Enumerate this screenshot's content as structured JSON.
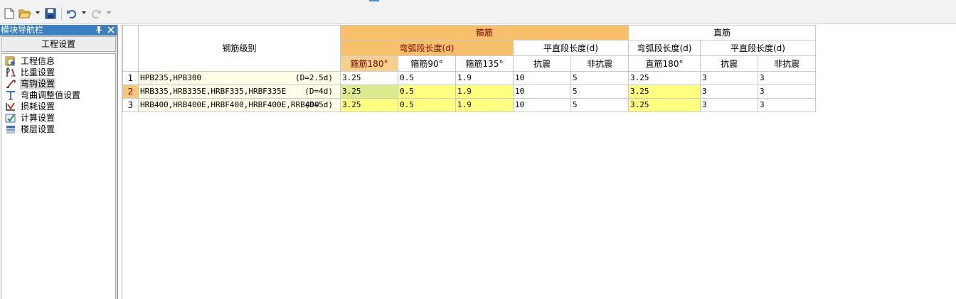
{
  "toolbar": {
    "buttons": [
      {
        "name": "new-icon"
      },
      {
        "name": "open-icon"
      },
      {
        "name": "save-icon"
      },
      {
        "name": "undo-icon"
      },
      {
        "name": "redo-icon"
      }
    ]
  },
  "navigator": {
    "title": "模块导航栏",
    "pin_glyph": "ꟼ",
    "close_glyph": "✕",
    "group": "工程设置",
    "items": [
      {
        "label": "工程信息",
        "icon": "project-info-icon"
      },
      {
        "label": "比重设置",
        "icon": "weight-ratio-icon"
      },
      {
        "label": "弯钩设置",
        "icon": "hook-icon",
        "selected": true
      },
      {
        "label": "弯曲调整值设置",
        "icon": "bend-adjust-icon"
      },
      {
        "label": "损耗设置",
        "icon": "loss-icon"
      },
      {
        "label": "计算设置",
        "icon": "calc-settings-icon"
      },
      {
        "label": "楼层设置",
        "icon": "floor-settings-icon"
      }
    ]
  },
  "grid": {
    "header": {
      "grade": "钢筋级别",
      "stirrup": "箍筋",
      "straight": "直筋",
      "stirrup_arc": "弯弧段长度(d)",
      "stirrup_flat": "平直段长度(d)",
      "straight_arc": "弯弧段长度(d)",
      "straight_flat": "平直段长度(d)",
      "cols": {
        "s180": "箍筋180°",
        "s90": "箍筋90°",
        "s135": "箍筋135°",
        "seismic": "抗震",
        "nonseismic": "非抗震",
        "z180": "直筋180°",
        "z_seismic": "抗震",
        "z_nonseismic": "非抗震"
      }
    },
    "rows": [
      {
        "num": "1",
        "grade": "HPB235,HPB300",
        "d": "(D=2.5d)",
        "s180": "3.25",
        "s90": "0.5",
        "s135": "1.9",
        "seismic": "10",
        "nonseismic": "5",
        "z180": "3.25",
        "z_seismic": "3",
        "z_nonseismic": "3"
      },
      {
        "num": "2",
        "grade": "HRB335,HRB335E,HRBF335,HRBF335E",
        "d": "(D=4d)",
        "s180": "3.25",
        "s90": "0.5",
        "s135": "1.9",
        "seismic": "10",
        "nonseismic": "5",
        "z180": "3.25",
        "z_seismic": "3",
        "z_nonseismic": "3"
      },
      {
        "num": "3",
        "grade": "HRB400,HRB400E,HRBF400,HRBF400E,RRB400",
        "d": "(D=5d)",
        "s180": "3.25",
        "s90": "0.5",
        "s135": "1.9",
        "seismic": "10",
        "nonseismic": "5",
        "z180": "3.25",
        "z_seismic": "3",
        "z_nonseismic": "3"
      }
    ],
    "colors": {
      "header_orange": "#f6c16a",
      "header_text": "#7a0000",
      "edited_yellow": "#ffff80",
      "active_green": "#dceb8f"
    }
  }
}
